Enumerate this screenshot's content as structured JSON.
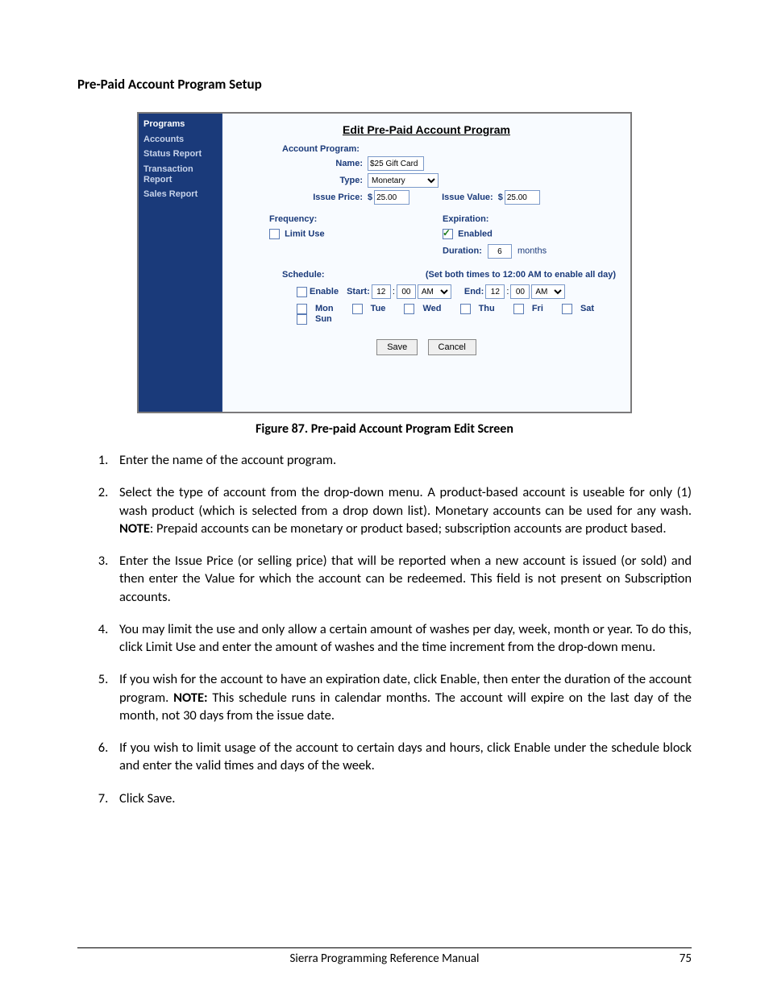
{
  "page": {
    "heading": "Pre-Paid Account Program Setup",
    "figure_caption": "Figure 87. Pre-paid Account Program Edit Screen",
    "footer_title": "Sierra Programming Reference Manual",
    "footer_page": "75"
  },
  "screenshot": {
    "sidebar": {
      "items": [
        "Programs",
        "Accounts",
        "Status Report",
        "Transaction Report",
        "Sales Report"
      ],
      "active_index": 0
    },
    "title": "Edit Pre-Paid Account Program",
    "account_program": {
      "section_label": "Account Program:",
      "name_label": "Name:",
      "name_value": "$25 Gift Card",
      "type_label": "Type:",
      "type_value": "Monetary",
      "issue_price_label": "Issue Price:",
      "issue_price_value": "25.00",
      "issue_value_label": "Issue Value:",
      "issue_value_value": "25.00"
    },
    "frequency": {
      "section_label": "Frequency:",
      "limit_use_label": "Limit Use"
    },
    "expiration": {
      "section_label": "Expiration:",
      "enabled_label": "Enabled",
      "enabled_checked": true,
      "duration_label": "Duration:",
      "duration_value": "6",
      "duration_unit": "months"
    },
    "schedule": {
      "section_label": "Schedule:",
      "note": "(Set both times to 12:00 AM to enable all day)",
      "enable_label": "Enable",
      "start_label": "Start:",
      "end_label": "End:",
      "hour": "12",
      "minute": "00",
      "ampm": "AM",
      "days": [
        "Mon",
        "Tue",
        "Wed",
        "Thu",
        "Fri",
        "Sat",
        "Sun"
      ]
    },
    "buttons": {
      "save": "Save",
      "cancel": "Cancel"
    }
  },
  "instructions": {
    "i1": "Enter the name of the account program.",
    "i2a": "Select the type of account from the drop-down menu. A product-based account is useable for only (1) wash product (which is selected from a drop down list). Monetary accounts can be used for any wash. ",
    "i2b": "NOTE",
    "i2c": ": Prepaid accounts can be monetary or product based; subscription accounts are product based.",
    "i3": "Enter the Issue Price (or selling price) that will be reported when a new account is issued (or sold) and then enter the Value for which the account can be redeemed. This field is not present on Subscription accounts.",
    "i4": "You may limit the use and only allow a certain amount of washes per day, week, month or year. To do this, click Limit Use and enter the amount of washes and the time increment from the drop-down menu.",
    "i5a": "If you wish for the account to have an expiration date, click Enable, then enter the duration of the account program. ",
    "i5b": "NOTE:",
    "i5c": " This schedule runs in calendar months. The account will expire on the last day of the month, not 30 days from the issue date.",
    "i6": "If you wish to limit usage of the account to certain days and hours, click Enable under the schedule block and enter the valid times and days of the week.",
    "i7": "Click Save."
  }
}
